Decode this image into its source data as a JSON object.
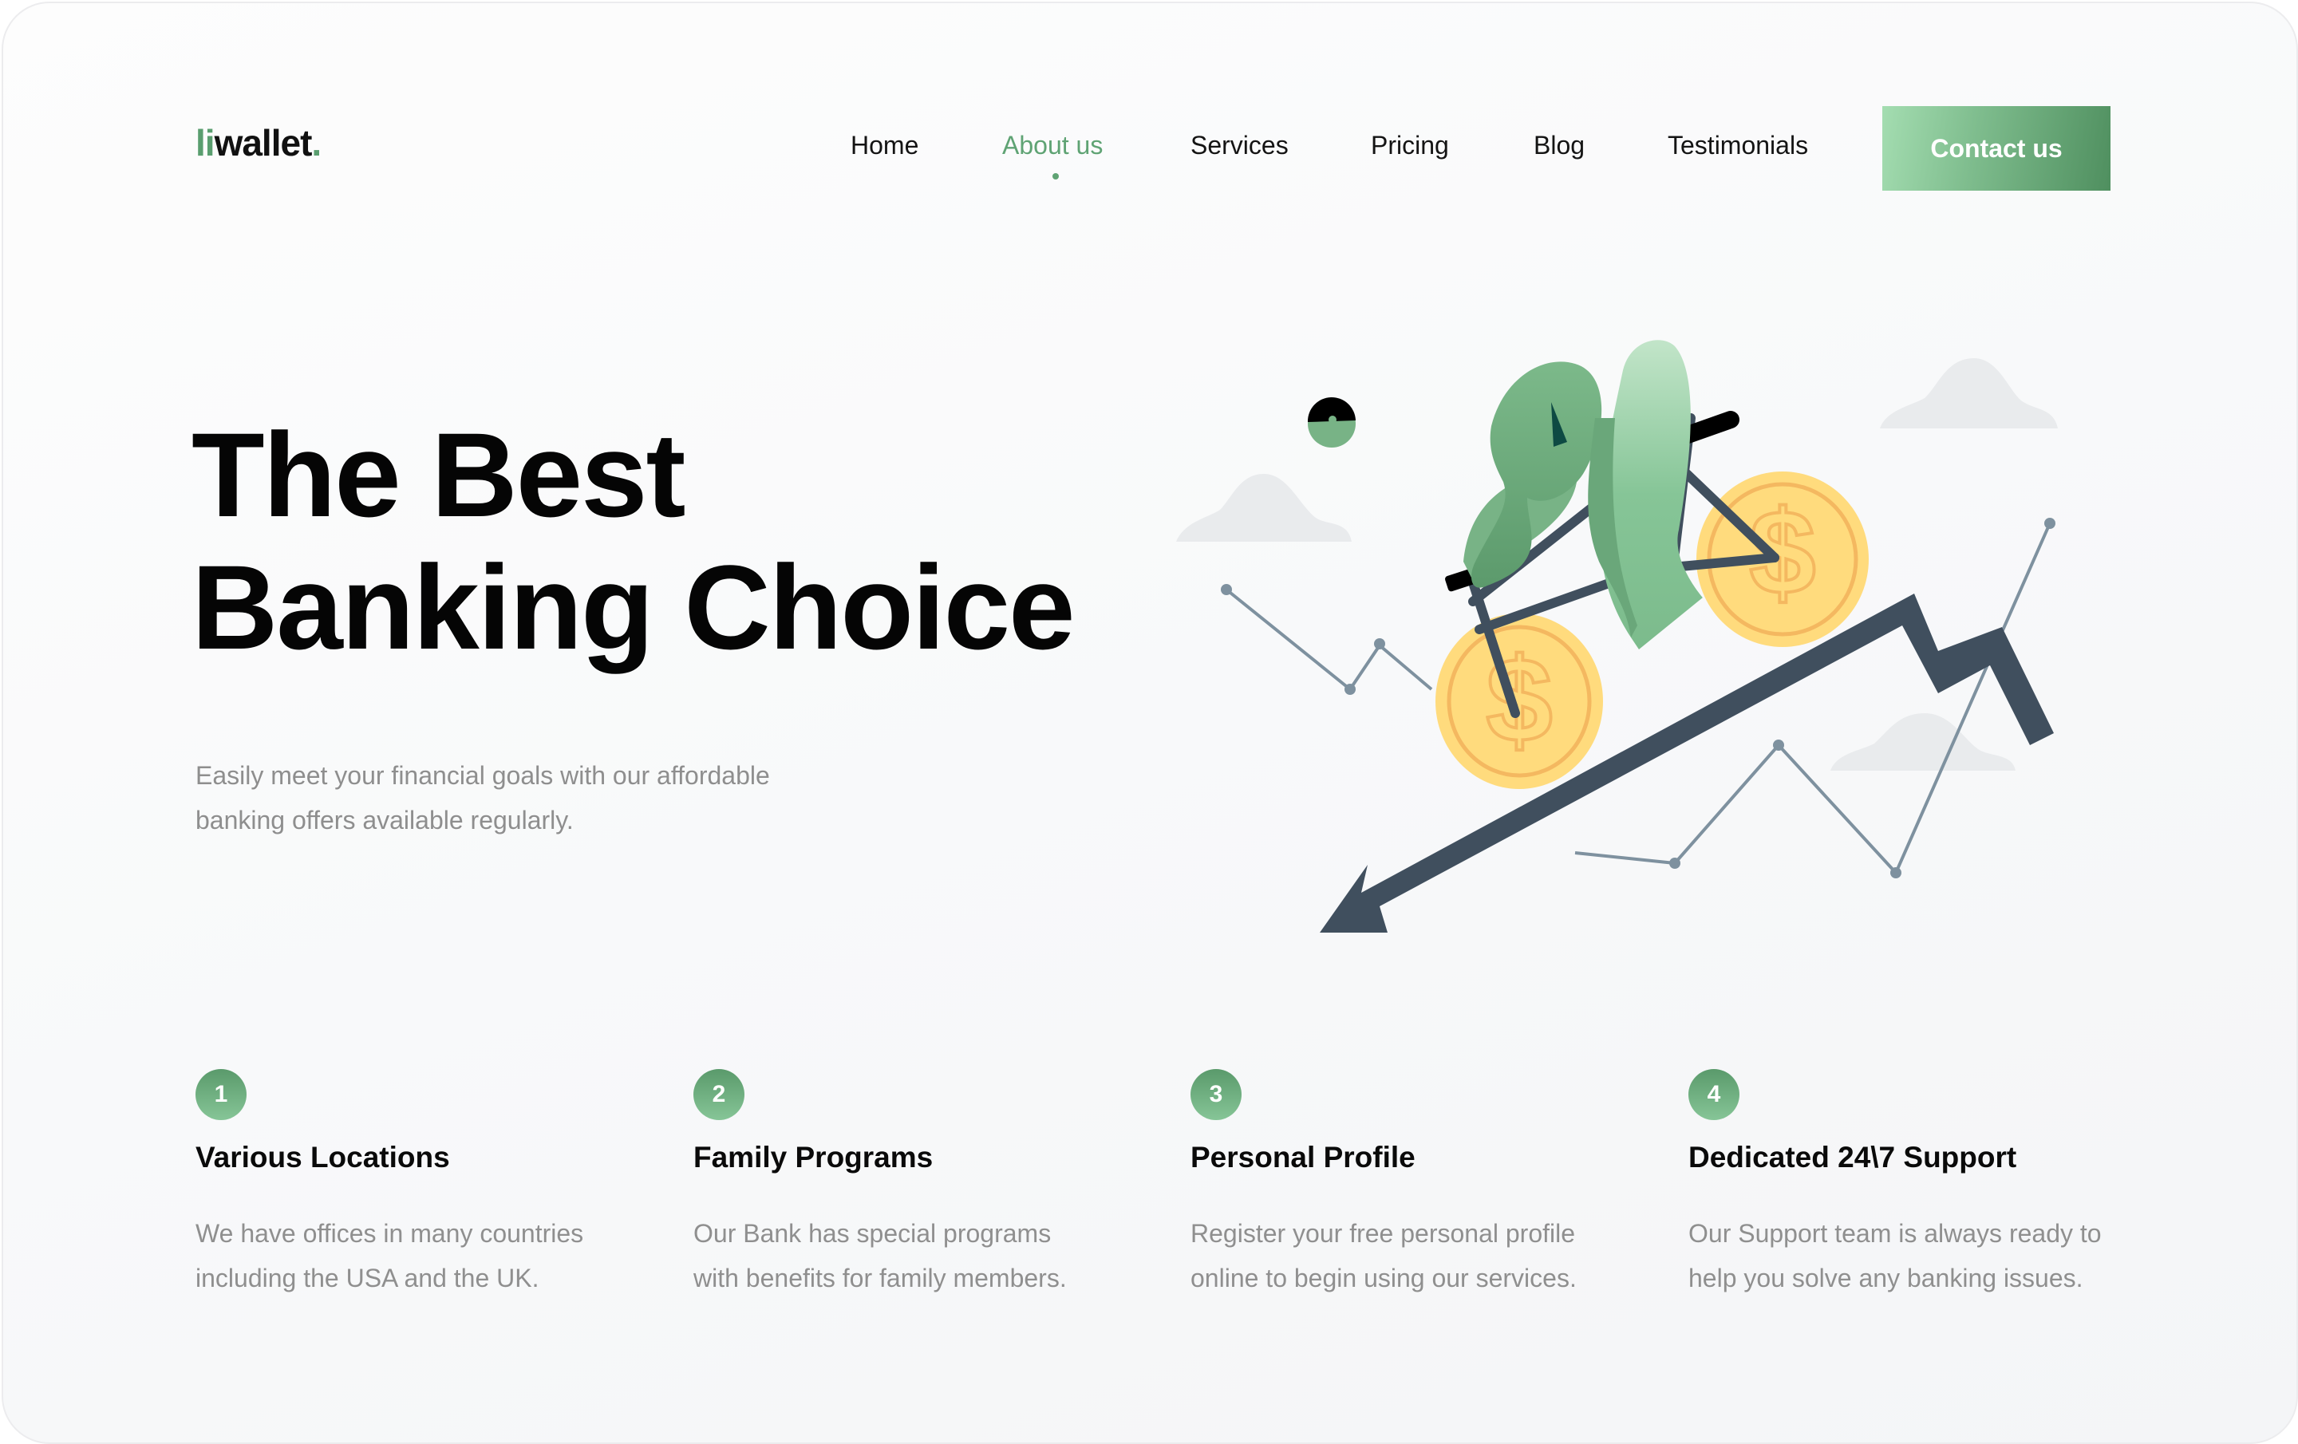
{
  "brand": {
    "prefix": "li",
    "name": "wallet",
    "dot": ".",
    "accent": "#5a9e6f"
  },
  "nav": {
    "items": [
      {
        "label": "Home",
        "active": false
      },
      {
        "label": "About us",
        "active": true
      },
      {
        "label": "Services",
        "active": false
      },
      {
        "label": "Pricing",
        "active": false
      },
      {
        "label": "Blog",
        "active": false
      },
      {
        "label": "Testimonials",
        "active": false
      }
    ],
    "cta_label": "Contact us"
  },
  "hero": {
    "title_line1": "The Best",
    "title_line2": "Banking Choice",
    "subtitle_line1": "Easily meet your financial goals with our affordable",
    "subtitle_line2": "banking offers available regularly.",
    "illustration": "cyclist-on-coin-bike-riding-up-chart-arrow"
  },
  "features": [
    {
      "number": "1",
      "title": "Various Locations",
      "desc_line1": "We have offices in many countries",
      "desc_line2": "including the USA and the UK."
    },
    {
      "number": "2",
      "title": "Family Programs",
      "desc_line1": "Our Bank has special programs",
      "desc_line2": "with benefits for family members."
    },
    {
      "number": "3",
      "title": "Personal Profile",
      "desc_line1": "Register your free personal profile",
      "desc_line2": "online to begin using our services."
    },
    {
      "number": "4",
      "title": "Dedicated 24\\7 Support",
      "desc_line1": "Our Support team is always ready to",
      "desc_line2": "help you solve any banking issues."
    }
  ],
  "colors": {
    "accent_green": "#5fa374",
    "button_gradient_start": "#a4ddb1",
    "button_gradient_end": "#4f8f5f",
    "coin_yellow": "#ffdb7d",
    "arrow_slate": "#404f5e",
    "text_muted": "#8e8e8e"
  }
}
